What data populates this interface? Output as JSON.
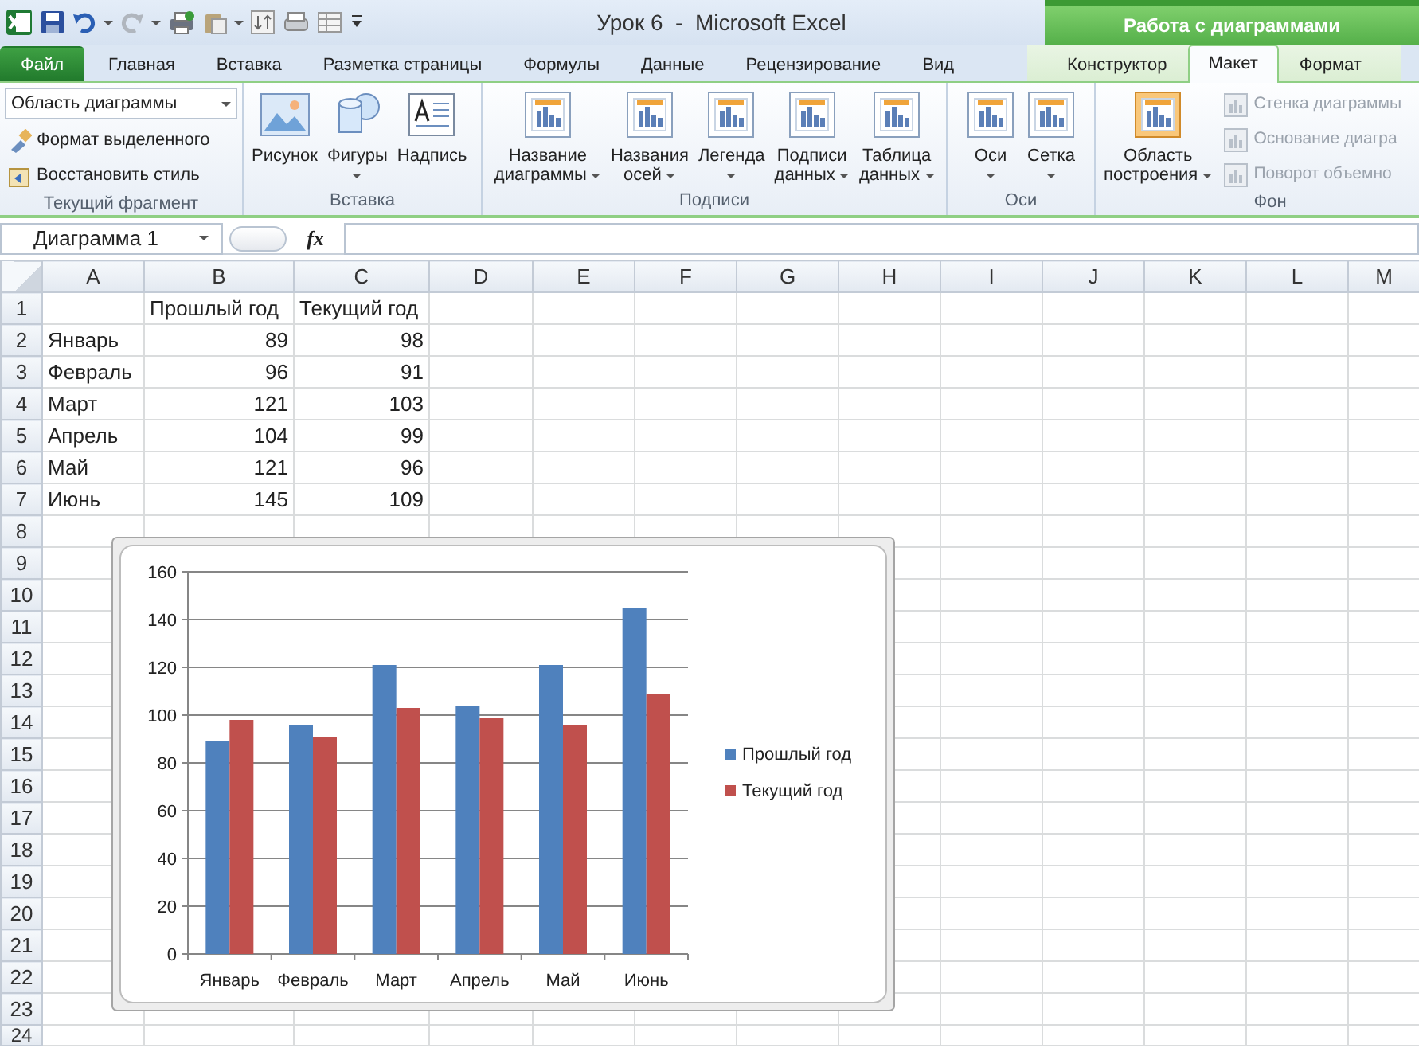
{
  "window": {
    "title": "Урок 6  -  Microsoft Excel"
  },
  "contextual_group": {
    "title": "Работа с диаграммами"
  },
  "tabs": [
    {
      "label": "Файл",
      "kind": "file",
      "selected": false
    },
    {
      "label": "Главная",
      "kind": "tab",
      "selected": false
    },
    {
      "label": "Вставка",
      "kind": "tab",
      "selected": false
    },
    {
      "label": "Разметка страницы",
      "kind": "tab",
      "selected": false
    },
    {
      "label": "Формулы",
      "kind": "tab",
      "selected": false
    },
    {
      "label": "Данные",
      "kind": "tab",
      "selected": false
    },
    {
      "label": "Рецензирование",
      "kind": "tab",
      "selected": false
    },
    {
      "label": "Вид",
      "kind": "tab",
      "selected": false
    },
    {
      "label": "Конструктор",
      "kind": "contextual",
      "selected": false
    },
    {
      "label": "Макет",
      "kind": "contextual",
      "selected": true
    },
    {
      "label": "Формат",
      "kind": "contextual",
      "selected": false
    }
  ],
  "ribbon": {
    "groups": [
      {
        "label": "Текущий фрагмент",
        "items": [
          {
            "kind": "dropdown",
            "label": "Область диаграммы"
          },
          {
            "kind": "small",
            "label": "Формат выделенного",
            "disabled": false
          },
          {
            "kind": "small",
            "label": "Восстановить стиль",
            "disabled": false
          }
        ]
      },
      {
        "label": "Вставка",
        "items": [
          {
            "kind": "large",
            "lines": [
              "Рисунок"
            ],
            "caret": false
          },
          {
            "kind": "large",
            "lines": [
              "Фигуры"
            ],
            "caret": true
          },
          {
            "kind": "large",
            "lines": [
              "Надпись"
            ],
            "caret": false
          }
        ]
      },
      {
        "label": "Подписи",
        "items": [
          {
            "kind": "large",
            "lines": [
              "Название",
              "диаграммы"
            ],
            "caret": true
          },
          {
            "kind": "large",
            "lines": [
              "Названия",
              "осей"
            ],
            "caret": true
          },
          {
            "kind": "large",
            "lines": [
              "Легенда"
            ],
            "caret": true
          },
          {
            "kind": "large",
            "lines": [
              "Подписи",
              "данных"
            ],
            "caret": true
          },
          {
            "kind": "large",
            "lines": [
              "Таблица",
              "данных"
            ],
            "caret": true
          }
        ]
      },
      {
        "label": "Оси",
        "items": [
          {
            "kind": "large",
            "lines": [
              "Оси"
            ],
            "caret": true
          },
          {
            "kind": "large",
            "lines": [
              "Сетка"
            ],
            "caret": true
          }
        ]
      },
      {
        "label": "Фон",
        "items": [
          {
            "kind": "large",
            "lines": [
              "Область",
              "построения"
            ],
            "caret": true
          },
          {
            "kind": "small",
            "label": "Стенка диаграммы",
            "disabled": true
          },
          {
            "kind": "small",
            "label": "Основание диагра",
            "disabled": true
          },
          {
            "kind": "small",
            "label": "Поворот объемно",
            "disabled": true
          }
        ]
      }
    ]
  },
  "formula_bar": {
    "name_box": "Диаграмма 1",
    "function_label": "fx"
  },
  "sheet": {
    "columns": [
      "A",
      "B",
      "C",
      "D",
      "E",
      "F",
      "G",
      "H",
      "I",
      "J",
      "K",
      "L",
      "M"
    ],
    "rows": [
      {
        "number": "1",
        "kind": "header",
        "cells": {
          "B": "Прошлый год",
          "C": "Текущий год"
        }
      },
      {
        "number": "2",
        "kind": "data",
        "cells": {
          "A": "Январь",
          "B": "89",
          "C": "98"
        }
      },
      {
        "number": "3",
        "kind": "data",
        "cells": {
          "A": "Февраль",
          "B": "96",
          "C": "91"
        }
      },
      {
        "number": "4",
        "kind": "data",
        "cells": {
          "A": "Март",
          "B": "121",
          "C": "103"
        }
      },
      {
        "number": "5",
        "kind": "data",
        "cells": {
          "A": "Апрель",
          "B": "104",
          "C": "99"
        }
      },
      {
        "number": "6",
        "kind": "data",
        "cells": {
          "A": "Май",
          "B": "121",
          "C": "96"
        }
      },
      {
        "number": "7",
        "kind": "data",
        "cells": {
          "A": "Июнь",
          "B": "145",
          "C": "109"
        }
      },
      {
        "number": "8"
      },
      {
        "number": "9"
      },
      {
        "number": "10"
      },
      {
        "number": "11"
      },
      {
        "number": "12"
      },
      {
        "number": "13"
      },
      {
        "number": "14"
      },
      {
        "number": "15"
      },
      {
        "number": "16"
      },
      {
        "number": "17"
      },
      {
        "number": "18"
      },
      {
        "number": "19"
      },
      {
        "number": "20"
      },
      {
        "number": "21"
      },
      {
        "number": "22"
      },
      {
        "number": "23"
      },
      {
        "number": "24"
      }
    ]
  },
  "chart": {
    "chart_data": {
      "type": "bar",
      "orientation": "vertical",
      "stacked": false,
      "categories": [
        "Январь",
        "Февраль",
        "Март",
        "Апрель",
        "Май",
        "Июнь"
      ],
      "series": [
        {
          "name": "Прошлый год",
          "color": "#4f81bd",
          "values": [
            89,
            96,
            121,
            104,
            121,
            145
          ]
        },
        {
          "name": "Текущий год",
          "color": "#c0504d",
          "values": [
            98,
            91,
            103,
            99,
            96,
            109
          ]
        }
      ],
      "ylim": [
        0,
        160
      ],
      "yticks": [
        {
          "value": 0,
          "label": "0"
        },
        {
          "value": 20,
          "label": "20"
        },
        {
          "value": 40,
          "label": "40"
        },
        {
          "value": 60,
          "label": "60"
        },
        {
          "value": 80,
          "label": "80"
        },
        {
          "value": 100,
          "label": "100"
        },
        {
          "value": 120,
          "label": "120"
        },
        {
          "value": 140,
          "label": "140"
        },
        {
          "value": 160,
          "label": "160"
        }
      ],
      "grid": true,
      "legend": true
    }
  }
}
